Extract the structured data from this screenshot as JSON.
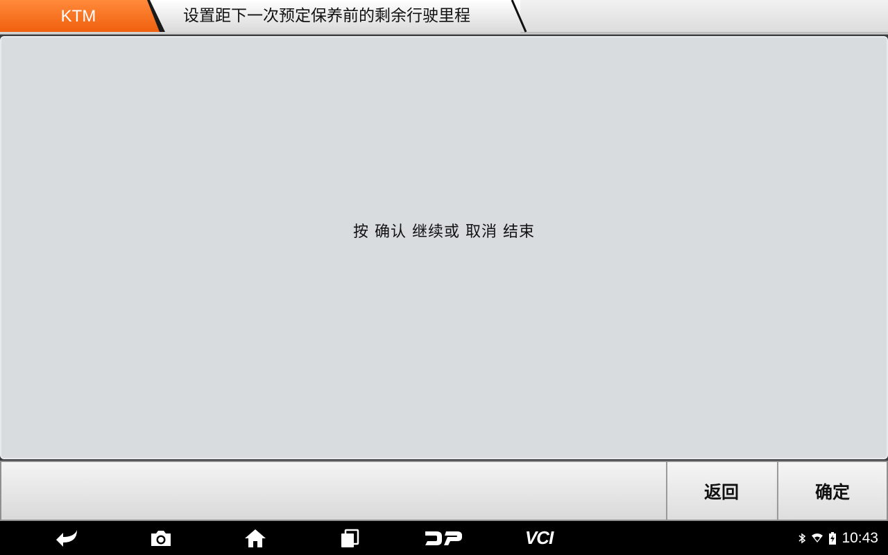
{
  "header": {
    "brand": "KTM",
    "title": "设置距下一次预定保养前的剩余行驶里程"
  },
  "content": {
    "message": "按 确认 继续或 取消 结束"
  },
  "actions": {
    "back_label": "返回",
    "ok_label": "确定"
  },
  "navbar": {
    "icons": [
      "back-icon",
      "camera-icon",
      "home-icon",
      "recent-apps-icon",
      "dp-icon",
      "vci-icon"
    ],
    "vci_label": "VCI"
  },
  "status_bar": {
    "icons": [
      "bluetooth-icon",
      "wifi-icon",
      "battery-charging-icon"
    ],
    "time": "10:43"
  },
  "colors": {
    "accent": "#f26a1b",
    "panel": "#d8dcdf",
    "navbar": "#000000"
  }
}
